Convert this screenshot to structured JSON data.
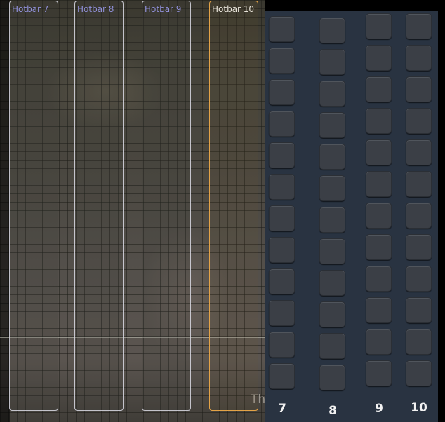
{
  "hotbars": [
    {
      "id": "7",
      "label": "Hotbar 7",
      "selected": false
    },
    {
      "id": "8",
      "label": "Hotbar 8",
      "selected": false
    },
    {
      "id": "9",
      "label": "Hotbar 9",
      "selected": false
    },
    {
      "id": "10",
      "label": "Hotbar 10",
      "selected": true
    }
  ],
  "slot_grid": {
    "columns": [
      {
        "label": "7",
        "slot_count": 12
      },
      {
        "label": "8",
        "slot_count": 12
      },
      {
        "label": "9",
        "slot_count": 12
      },
      {
        "label": "10",
        "slot_count": 12
      }
    ]
  },
  "scene": {
    "partial_text": "Th"
  },
  "colors": {
    "panel_background": "#293341",
    "slot_fill": "#3b3f46",
    "selected_outline": "#e4a347",
    "hotbar_label": "#9090d8"
  }
}
